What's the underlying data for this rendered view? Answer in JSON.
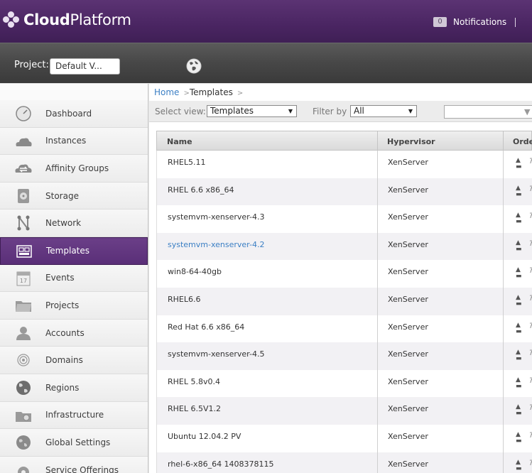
{
  "header": {
    "logo_bold": "Cloud",
    "logo_regular": "Platform",
    "notifications_count": "0",
    "notifications_label": "Notifications",
    "separator": "|"
  },
  "project_bar": {
    "label": "Project:",
    "selected_project": "Default V..."
  },
  "sidebar": {
    "items": [
      {
        "label": "Dashboard",
        "icon": "dashboard-icon"
      },
      {
        "label": "Instances",
        "icon": "cloud-icon"
      },
      {
        "label": "Affinity Groups",
        "icon": "affinity-icon"
      },
      {
        "label": "Storage",
        "icon": "storage-icon"
      },
      {
        "label": "Network",
        "icon": "network-icon"
      },
      {
        "label": "Templates",
        "icon": "templates-icon",
        "active": true
      },
      {
        "label": "Events",
        "icon": "calendar-icon",
        "icon_text": "17"
      },
      {
        "label": "Projects",
        "icon": "folder-icon"
      },
      {
        "label": "Accounts",
        "icon": "user-icon"
      },
      {
        "label": "Domains",
        "icon": "domains-icon"
      },
      {
        "label": "Regions",
        "icon": "globe-icon"
      },
      {
        "label": "Infrastructure",
        "icon": "infrastructure-icon"
      },
      {
        "label": "Global Settings",
        "icon": "settings-icon"
      },
      {
        "label": "Service Offerings",
        "icon": "gear-icon"
      }
    ]
  },
  "breadcrumb": {
    "home": "Home",
    "separator": ">",
    "current": "Templates",
    "trailing": ">"
  },
  "toolbar": {
    "select_view_label": "Select view:",
    "select_view_value": "Templates",
    "filter_label": "Filter by",
    "filter_value": "All",
    "search_value": ""
  },
  "table": {
    "columns": [
      "Name",
      "Hypervisor",
      "Orde"
    ],
    "rows": [
      {
        "name": "RHEL5.11",
        "hypervisor": "XenServer"
      },
      {
        "name": "RHEL 6.6 x86_64",
        "hypervisor": "XenServer"
      },
      {
        "name": "systemvm-xenserver-4.3",
        "hypervisor": "XenServer"
      },
      {
        "name": "systemvm-xenserver-4.2",
        "hypervisor": "XenServer",
        "link": true
      },
      {
        "name": "win8-64-40gb",
        "hypervisor": "XenServer"
      },
      {
        "name": "RHEL6.6",
        "hypervisor": "XenServer"
      },
      {
        "name": "Red Hat 6.6 x86_64",
        "hypervisor": "XenServer"
      },
      {
        "name": "systemvm-xenserver-4.5",
        "hypervisor": "XenServer"
      },
      {
        "name": "RHEL 5.8v0.4",
        "hypervisor": "XenServer"
      },
      {
        "name": "RHEL 6.5V1.2",
        "hypervisor": "XenServer"
      },
      {
        "name": "Ubuntu 12.04.2 PV",
        "hypervisor": "XenServer"
      },
      {
        "name": "rhel-6-x86_64 1408378115",
        "hypervisor": "XenServer"
      }
    ]
  },
  "colors": {
    "header_purple": "#4a2562",
    "active_nav": "#5a2f78",
    "link_blue": "#3b7fc4"
  }
}
